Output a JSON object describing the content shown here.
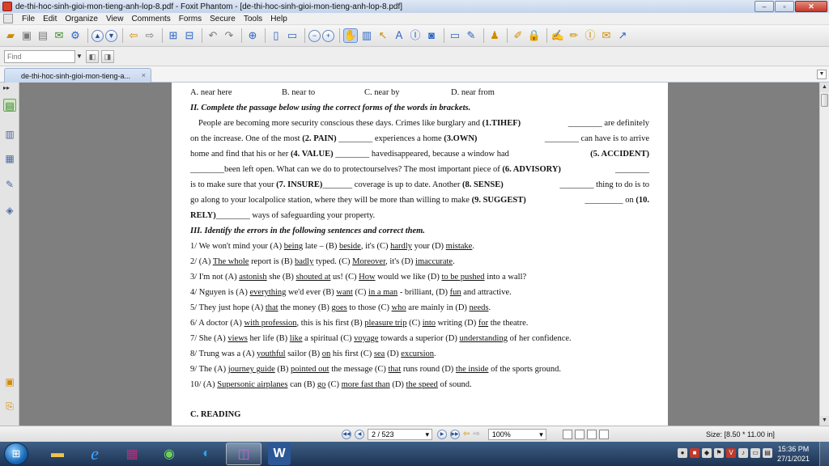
{
  "window": {
    "title": "de-thi-hoc-sinh-gioi-mon-tieng-anh-lop-8.pdf - Foxit Phantom - [de-thi-hoc-sinh-gioi-mon-tieng-anh-lop-8.pdf]",
    "minimize_glyph": "–",
    "restore_glyph": "▫",
    "close_glyph": "✕"
  },
  "menu": [
    "File",
    "Edit",
    "Organize",
    "View",
    "Comments",
    "Forms",
    "Secure",
    "Tools",
    "Help"
  ],
  "find": {
    "placeholder": "Find"
  },
  "tab": {
    "label": "de-thi-hoc-sinh-gioi-mon-tieng-a...",
    "close_glyph": "×"
  },
  "left_panel": {
    "collapse_glyph": "▸▸"
  },
  "document": {
    "options_row": [
      "A. near here",
      "B. near to",
      "C. near by",
      "D. near from"
    ],
    "section2_heading": "II. Complete the passage below using the correct forms of the words in brackets.",
    "passage": {
      "l1": [
        "People are becoming more security conscious these days. Crimes like burglary and ",
        "(1.TIHEF)",
        "________ are definitely"
      ],
      "l2": [
        "on the increase. One of the most ",
        "(2. PAIN)",
        " ________ experiences a home ",
        "(3.OWN)",
        " ________ can have is to arrive"
      ],
      "l3": [
        "home and find that his or her ",
        "(4. VALUE)",
        " ________ havedisappeared, because a window had ",
        "(5. ACCIDENT)"
      ],
      "l4": [
        "________been left open. What can we do to protectourselves? The most important piece of ",
        "(6. ADVISORY)",
        " ________"
      ],
      "l5": [
        "is to make sure that your ",
        "(7. INSURE)",
        "_______ coverage is up to date. Another ",
        "(8. SENSE)",
        " ________ thing to do is to"
      ],
      "l6": [
        "go along to your localpolice station, where they will be more than willing to make ",
        "(9. SUGGEST)",
        " _________ on ",
        "(10."
      ],
      "l7": [
        "RELY)",
        "________ ways of safeguarding your property."
      ]
    },
    "section3_heading": "III. Identify the errors in the following sentences and correct them.",
    "sentences": [
      [
        [
          "1/ We won't mind your (A) ",
          0
        ],
        [
          "being",
          1
        ],
        [
          " late – (B) ",
          0
        ],
        [
          "beside",
          1
        ],
        [
          ", it's (C) ",
          0
        ],
        [
          "hardly",
          1
        ],
        [
          " your (D) ",
          0
        ],
        [
          "mistake",
          1
        ],
        [
          ".",
          0
        ]
      ],
      [
        [
          "2/ (A) ",
          0
        ],
        [
          "The whole",
          1
        ],
        [
          " report is (B) ",
          0
        ],
        [
          "badly",
          1
        ],
        [
          " typed. (C) ",
          0
        ],
        [
          "Moreover",
          1
        ],
        [
          ", it's (D) ",
          0
        ],
        [
          "imaccurate",
          1
        ],
        [
          ".",
          0
        ]
      ],
      [
        [
          "3/ I'm not (A) ",
          0
        ],
        [
          "astonish",
          1
        ],
        [
          " she (B) ",
          0
        ],
        [
          "shouted at",
          1
        ],
        [
          " us! (C) ",
          0
        ],
        [
          "How",
          1
        ],
        [
          " would we like (D) ",
          0
        ],
        [
          "to be pushed",
          1
        ],
        [
          " into a wall?",
          0
        ]
      ],
      [
        [
          "4/ Nguyen is (A) ",
          0
        ],
        [
          "everything",
          1
        ],
        [
          " we'd ever (B) ",
          0
        ],
        [
          "want",
          1
        ],
        [
          " (C) ",
          0
        ],
        [
          "in a man",
          1
        ],
        [
          " - brilliant, (D) ",
          0
        ],
        [
          "fun",
          1
        ],
        [
          " and attractive.",
          0
        ]
      ],
      [
        [
          "5/ They just hope (A) ",
          0
        ],
        [
          "that",
          1
        ],
        [
          " the money (B) ",
          0
        ],
        [
          "goes",
          1
        ],
        [
          " to those (C) ",
          0
        ],
        [
          "who",
          1
        ],
        [
          " are mainly in (D) ",
          0
        ],
        [
          "needs",
          1
        ],
        [
          ".",
          0
        ]
      ],
      [
        [
          "6/ A doctor (A) ",
          0
        ],
        [
          "with profession",
          1
        ],
        [
          ", this is his first (B) ",
          0
        ],
        [
          "pleasure trip",
          1
        ],
        [
          " (C) ",
          0
        ],
        [
          "into",
          1
        ],
        [
          " writing (D) ",
          0
        ],
        [
          "for",
          1
        ],
        [
          " the theatre.",
          0
        ]
      ],
      [
        [
          "7/ She (A) ",
          0
        ],
        [
          "views",
          1
        ],
        [
          " her life (B) ",
          0
        ],
        [
          "like",
          1
        ],
        [
          " a spiritual (C) ",
          0
        ],
        [
          "voyage",
          1
        ],
        [
          " towards a superior (D) ",
          0
        ],
        [
          "understanding",
          1
        ],
        [
          " of her confidence.",
          0
        ]
      ],
      [
        [
          "8/ Trung was a (A) ",
          0
        ],
        [
          "youthful",
          1
        ],
        [
          " sailor (B) ",
          0
        ],
        [
          "on",
          1
        ],
        [
          " his first (C) ",
          0
        ],
        [
          "sea",
          1
        ],
        [
          " (D) ",
          0
        ],
        [
          "excursion",
          1
        ],
        [
          ".",
          0
        ]
      ],
      [
        [
          "9/ The (A) ",
          0
        ],
        [
          "journey guide",
          1
        ],
        [
          " (B) ",
          0
        ],
        [
          "pointed out",
          1
        ],
        [
          " the message (C) ",
          0
        ],
        [
          "that",
          1
        ],
        [
          " runs round (D) ",
          0
        ],
        [
          "the inside",
          1
        ],
        [
          " of the sports ground.",
          0
        ]
      ],
      [
        [
          "10/ (A) ",
          0
        ],
        [
          "Supersonic airplanes",
          1
        ],
        [
          " can (B) ",
          0
        ],
        [
          "go",
          1
        ],
        [
          " (C) ",
          0
        ],
        [
          "more fast than",
          1
        ],
        [
          " (D) ",
          0
        ],
        [
          "the speed",
          1
        ],
        [
          " of sound.",
          0
        ]
      ]
    ],
    "section_c_heading": "C. READING"
  },
  "status": {
    "page": "2 / 523",
    "zoom": "100%",
    "size": "Size: [8.50 * 11.00 in]"
  },
  "taskbar": {
    "time": "15:36 PM",
    "date": "27/1/2021"
  }
}
